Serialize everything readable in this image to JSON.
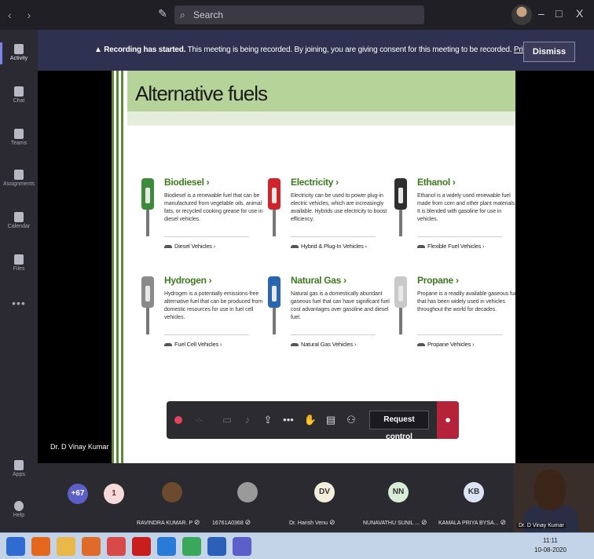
{
  "titlebar": {
    "nav": "‹ ›",
    "compose_icon": "compose-icon",
    "search_placeholder": "Search",
    "window_buttons": [
      "–",
      "□",
      "X"
    ]
  },
  "rail": [
    {
      "label": "Activity",
      "active": true
    },
    {
      "label": "Chat"
    },
    {
      "label": "Teams"
    },
    {
      "label": "Assignments"
    },
    {
      "label": "Calendar"
    },
    {
      "label": "Files"
    }
  ],
  "rail_more": "•••",
  "rail_bottom": [
    {
      "label": "Apps"
    },
    {
      "label": "Help"
    }
  ],
  "banner": {
    "bold": "Recording has started.",
    "text": " This meeting is being recorded. By joining, you are giving consent for this meeting to be recorded. ",
    "link": "Privacy policy",
    "dismiss": "Dismiss"
  },
  "presenter": "Dr. D Vinay Kumar",
  "slide": {
    "title": "Alternative fuels",
    "fuels": [
      {
        "name": "Biodiesel ›",
        "desc": "Biodiesel is a renewable fuel that can be manufactured from vegetable oils, animal fats, or recycled cooking grease for use in diesel vehicles.",
        "link": "Diesel Vehicles ›",
        "color": "#3c8a3a"
      },
      {
        "name": "Electricity ›",
        "desc": "Electricity can be used to power plug-in electric vehicles, which are increasingly available. Hybrids use electricity to boost efficiency.",
        "link": "Hybrid & Plug-In Vehicles ›",
        "color": "#d2232a"
      },
      {
        "name": "Ethanol ›",
        "desc": "Ethanol is a widely used renewable fuel made from corn and other plant materials. It is blended with gasoline for use in vehicles.",
        "link": "Flexible Fuel Vehicles ›",
        "color": "#2f2f2f"
      },
      {
        "name": "Hydrogen ›",
        "desc": "Hydrogen is a potentially emissions-free alternative fuel that can be produced from domestic resources for use in fuel cell vehicles.",
        "link": "Fuel Cell Vehicles ›",
        "color": "#8a8a8a"
      },
      {
        "name": "Natural Gas ›",
        "desc": "Natural gas is a domestically abundant gaseous fuel that can have significant fuel cost advantages over gasoline and diesel fuel.",
        "link": "Natural Gas Vehicles ›",
        "color": "#2a66b0"
      },
      {
        "name": "Propane ›",
        "desc": "Propane is a readily available gaseous fuel that has been widely used in vehicles throughout the world for decades.",
        "link": "Propane Vehicles ›",
        "color": "#c9c9c9"
      }
    ]
  },
  "controls": {
    "timer": "-:-",
    "request_control": "Request control"
  },
  "participants": {
    "overflow_count": "+67",
    "count_badge": "1",
    "tiles": [
      {
        "name": "RAVINDRA KUMAR. P",
        "initials": "",
        "bg": "#6b4a2e"
      },
      {
        "name": "16761A0368",
        "initials": "",
        "bg": "#9a9a9a"
      },
      {
        "name": "Dr. Harish Venu",
        "initials": "DV",
        "bg": "#f3eedb"
      },
      {
        "name": "NUNAVATHU SUNIL ...",
        "initials": "NN",
        "bg": "#d8ecd6"
      },
      {
        "name": "KAMALA PRIYA BYSA...",
        "initials": "KB",
        "bg": "#dbe4f5"
      }
    ],
    "camera_name": "Dr. D Vinay Kumar"
  },
  "taskbar": {
    "apps": [
      {
        "icon": "windows-start-icon",
        "color": "#2f6bd0"
      },
      {
        "icon": "firefox-icon",
        "color": "#e5661d"
      },
      {
        "icon": "file-explorer-icon",
        "color": "#e8b84a"
      },
      {
        "icon": "media-player-icon",
        "color": "#e06a2a"
      },
      {
        "icon": "paint-icon",
        "color": "#d84a4a"
      },
      {
        "icon": "acrobat-icon",
        "color": "#c81e1e"
      },
      {
        "icon": "internet-explorer-icon",
        "color": "#2a7ad8"
      },
      {
        "icon": "chrome-icon",
        "color": "#3aa85a"
      },
      {
        "icon": "word-icon",
        "color": "#2b5fb8"
      },
      {
        "icon": "teams-icon",
        "color": "#5b5fc7"
      }
    ],
    "time": "11:11",
    "date": "10-08-2020"
  }
}
